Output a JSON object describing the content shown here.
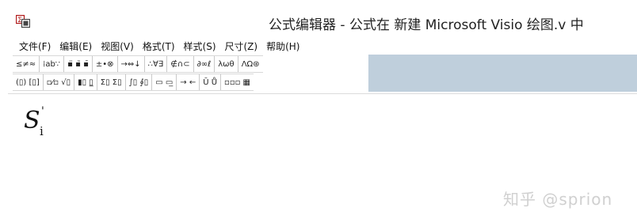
{
  "window": {
    "title": "公式编辑器 - 公式在 新建 Microsoft Visio 绘图.v 中",
    "app_icon": "sigma-box-icon"
  },
  "menu": {
    "items": [
      "文件(F)",
      "编辑(E)",
      "视图(V)",
      "格式(T)",
      "样式(S)",
      "尺寸(Z)",
      "帮助(H)"
    ]
  },
  "toolbar": {
    "row1": [
      "≤≠≈",
      "⁞ab∵",
      "▪̈ ▪̃ ▪̄",
      "±•⊗",
      "→⇔↓",
      "∴∀∃",
      "∉∩⊂",
      "∂∞ℓ",
      "λωθ",
      "ΛΩ⊛"
    ],
    "row2": [
      "(▯) [▯]",
      "▫⁄▫ √▯",
      "▮▯ ▯̲",
      "Σ▯ Σ▯",
      "∫▯ ∮▯",
      "▭ ▭̲",
      "→ ←",
      "Ū Ů",
      "▫▫▫ ▦"
    ]
  },
  "formula": {
    "main": "S",
    "superscript": "'",
    "subscript": "i"
  },
  "watermark": "知乎 @sprion"
}
